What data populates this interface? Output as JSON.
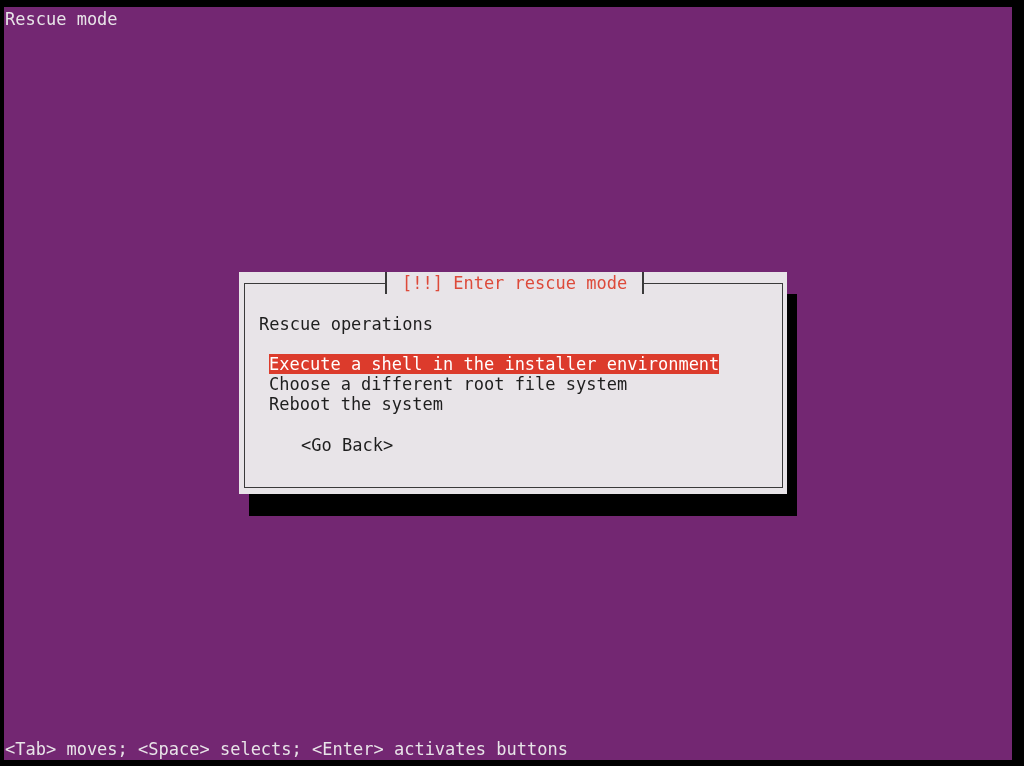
{
  "screen_title": "Rescue mode",
  "dialog": {
    "title": "[!!] Enter rescue mode",
    "prompt": "Rescue operations",
    "options": [
      {
        "label": "Execute a shell in the installer environment",
        "selected": true
      },
      {
        "label": "Choose a different root file system",
        "selected": false
      },
      {
        "label": "Reboot the system",
        "selected": false
      }
    ],
    "buttons": [
      {
        "label": "<Go Back>",
        "selected": false
      }
    ]
  },
  "help_line": "<Tab> moves; <Space> selects; <Enter> activates buttons"
}
